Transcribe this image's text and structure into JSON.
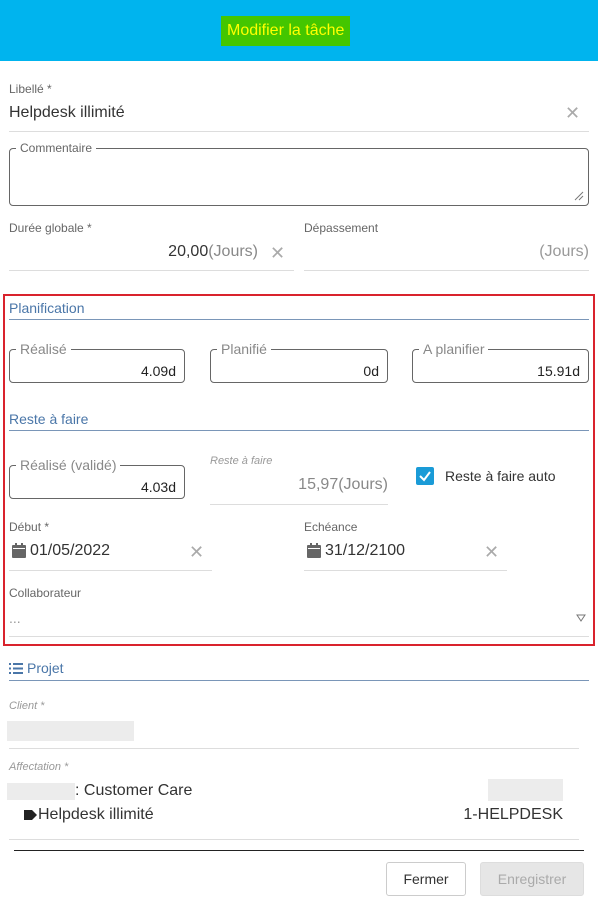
{
  "header": {
    "title": "Modifier la tâche"
  },
  "libelle": {
    "label": "Libellé *",
    "value": "Helpdesk illimité"
  },
  "commentaire": {
    "label": "Commentaire",
    "value": ""
  },
  "duree": {
    "label": "Durée globale *",
    "value": "20,00",
    "unit": "(Jours)"
  },
  "depassement": {
    "label": "Dépassement",
    "unit": "(Jours)"
  },
  "planification": {
    "title": "Planification",
    "realise": {
      "label": "Réalisé",
      "value": "4.09d"
    },
    "planifie": {
      "label": "Planifié",
      "value": "0d"
    },
    "a_planifier": {
      "label": "A planifier",
      "value": "15.91d"
    }
  },
  "reste": {
    "title": "Reste à faire",
    "realise_valide": {
      "label": "Réalisé (validé)",
      "value": "4.03d"
    },
    "reste_a_faire": {
      "label": "Reste à faire",
      "value": "15,97",
      "unit": "(Jours)"
    },
    "auto": {
      "label": "Reste à faire auto",
      "checked": true
    }
  },
  "debut": {
    "label": "Début *",
    "value": "01/05/2022"
  },
  "echeance": {
    "label": "Echéance",
    "value": "31/12/2100"
  },
  "collaborateur": {
    "label": "Collaborateur",
    "value": "..."
  },
  "projet": {
    "title": "Projet",
    "client_label": "Client *",
    "affectation_label": "Affectation *",
    "affectation_name": ": Customer Care",
    "task_name": "Helpdesk illimité",
    "task_code": "1-HELPDESK"
  },
  "footer": {
    "close_label": "Fermer",
    "save_label": "Enregistrer"
  },
  "colors": {
    "header": "#00b4ee",
    "title_bg": "#44c600",
    "title_text": "#ffff00",
    "accent": "#4a76a8",
    "highlight_border": "#d9232d",
    "checkbox": "#1a9bd7"
  },
  "icons": [
    "close-icon",
    "resize-grip-icon",
    "check-icon",
    "calendar-icon",
    "dropdown-arrow-icon",
    "list-icon",
    "tag-icon"
  ]
}
